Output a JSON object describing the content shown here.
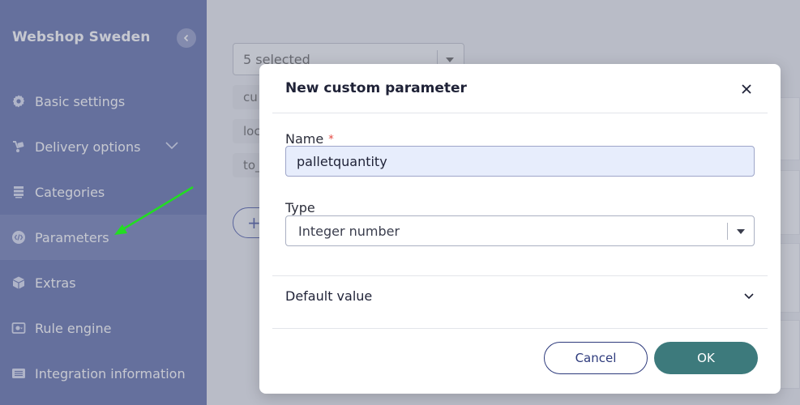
{
  "sidebar": {
    "brand": "Webshop Sweden",
    "items": [
      {
        "label": "Basic settings",
        "icon": "gear-icon"
      },
      {
        "label": "Delivery options",
        "icon": "delivery-icon"
      },
      {
        "label": "Categories",
        "icon": "categories-icon"
      },
      {
        "label": "Parameters",
        "icon": "code-icon"
      },
      {
        "label": "Extras",
        "icon": "box-icon"
      },
      {
        "label": "Rule engine",
        "icon": "rule-engine-icon"
      },
      {
        "label": "Integration information",
        "icon": "list-icon"
      }
    ]
  },
  "background": {
    "select_value": "5 selected",
    "chips": [
      "cu",
      "loc",
      "to_"
    ],
    "add_button": "+"
  },
  "modal": {
    "title": "New custom parameter",
    "name_label": "Name",
    "required_mark": "*",
    "name_value": "palletquantity",
    "type_label": "Type",
    "type_value": "Integer number",
    "default_value_label": "Default value",
    "cancel_label": "Cancel",
    "ok_label": "OK"
  },
  "colors": {
    "sidebar_bg": "#4f5fa3",
    "accent": "#3d7a7c",
    "annotation_arrow": "#22dd22"
  }
}
